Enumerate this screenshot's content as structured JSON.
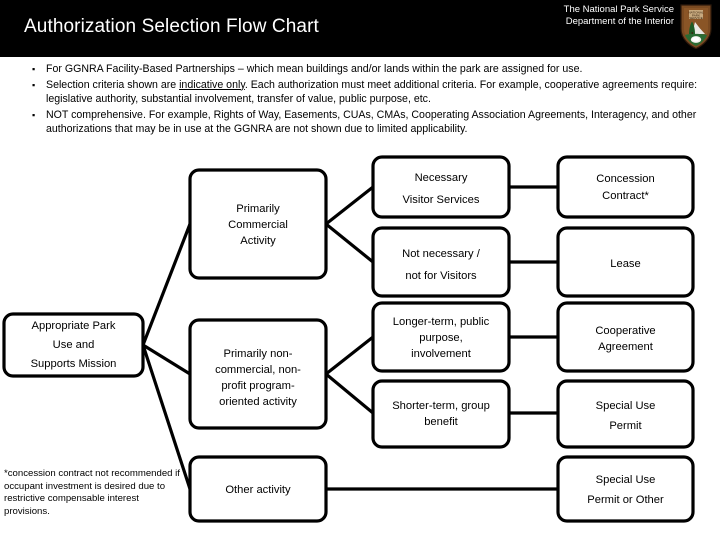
{
  "header": {
    "title": "Authorization Selection Flow Chart",
    "agency_line1": "The National Park Service",
    "agency_line2": "Department of the Interior",
    "logo_icon": "nps-arrowhead-icon",
    "background_color": "#000000",
    "text_color": "#ffffff"
  },
  "intro": {
    "bullet_glyph": "▪",
    "items": [
      {
        "pre": "For GGNRA Facility-Based Partnerships – which mean buildings and/or lands within the park are assigned for use.",
        "emphasis": "",
        "post": ""
      },
      {
        "pre": "Selection criteria shown are ",
        "emphasis": "indicative only",
        "post": ". Each authorization must meet additional criteria. For example, cooperative agreements require: legislative authority, substantial involvement, transfer of value, public purpose, etc."
      },
      {
        "pre": "NOT comprehensive. For example, Rights of Way, Easements, CUAs, CMAs, Cooperating Association Agreements, Interagency, and other authorizations that may be in use at the GGNRA are not shown due to limited applicability.",
        "emphasis": "",
        "post": ""
      }
    ]
  },
  "chart_data": {
    "type": "diagram",
    "title": "Authorization Selection Flow Chart",
    "nodes": {
      "root": {
        "lines": [
          "Appropriate Park",
          "Use and",
          "Supports Mission"
        ]
      },
      "activity_commercial": {
        "lines": [
          "Primarily",
          "Commercial",
          "Activity"
        ]
      },
      "activity_nonprofit": {
        "lines": [
          "Primarily non-",
          "commercial, non-",
          "profit program-",
          "oriented activity"
        ]
      },
      "activity_other": {
        "lines": [
          "Other activity"
        ]
      },
      "criteria_necessary": {
        "lines": [
          "Necessary",
          "Visitor Services"
        ]
      },
      "criteria_not_necessary": {
        "lines": [
          "Not necessary /",
          "not for Visitors"
        ]
      },
      "criteria_longer_term": {
        "lines": [
          "Longer-term, public",
          "purpose,",
          "involvement"
        ]
      },
      "criteria_shorter_term": {
        "lines": [
          "Shorter-term, group",
          "benefit"
        ]
      },
      "outcome_concession": {
        "lines": [
          "Concession",
          "Contract*"
        ]
      },
      "outcome_lease": {
        "lines": [
          "Lease"
        ]
      },
      "outcome_coop": {
        "lines": [
          "Cooperative",
          "Agreement"
        ]
      },
      "outcome_sup": {
        "lines": [
          "Special Use",
          "Permit"
        ]
      },
      "outcome_sup_other": {
        "lines": [
          "Special Use",
          "Permit or Other"
        ]
      }
    },
    "edges": [
      {
        "from": "root",
        "to": "activity_commercial"
      },
      {
        "from": "root",
        "to": "activity_nonprofit"
      },
      {
        "from": "root",
        "to": "activity_other"
      },
      {
        "from": "activity_commercial",
        "to": "criteria_necessary"
      },
      {
        "from": "activity_commercial",
        "to": "criteria_not_necessary"
      },
      {
        "from": "activity_nonprofit",
        "to": "criteria_longer_term"
      },
      {
        "from": "activity_nonprofit",
        "to": "criteria_shorter_term"
      },
      {
        "from": "criteria_necessary",
        "to": "outcome_concession"
      },
      {
        "from": "criteria_not_necessary",
        "to": "outcome_lease"
      },
      {
        "from": "criteria_longer_term",
        "to": "outcome_coop"
      },
      {
        "from": "criteria_shorter_term",
        "to": "outcome_sup"
      },
      {
        "from": "activity_other",
        "to": "outcome_sup_other"
      }
    ],
    "node_fill": "#ffffff",
    "node_stroke": "#000000"
  },
  "footnote": {
    "text": "*concession contract not recommended if occupant investment is desired due to restrictive compensable interest provisions."
  }
}
